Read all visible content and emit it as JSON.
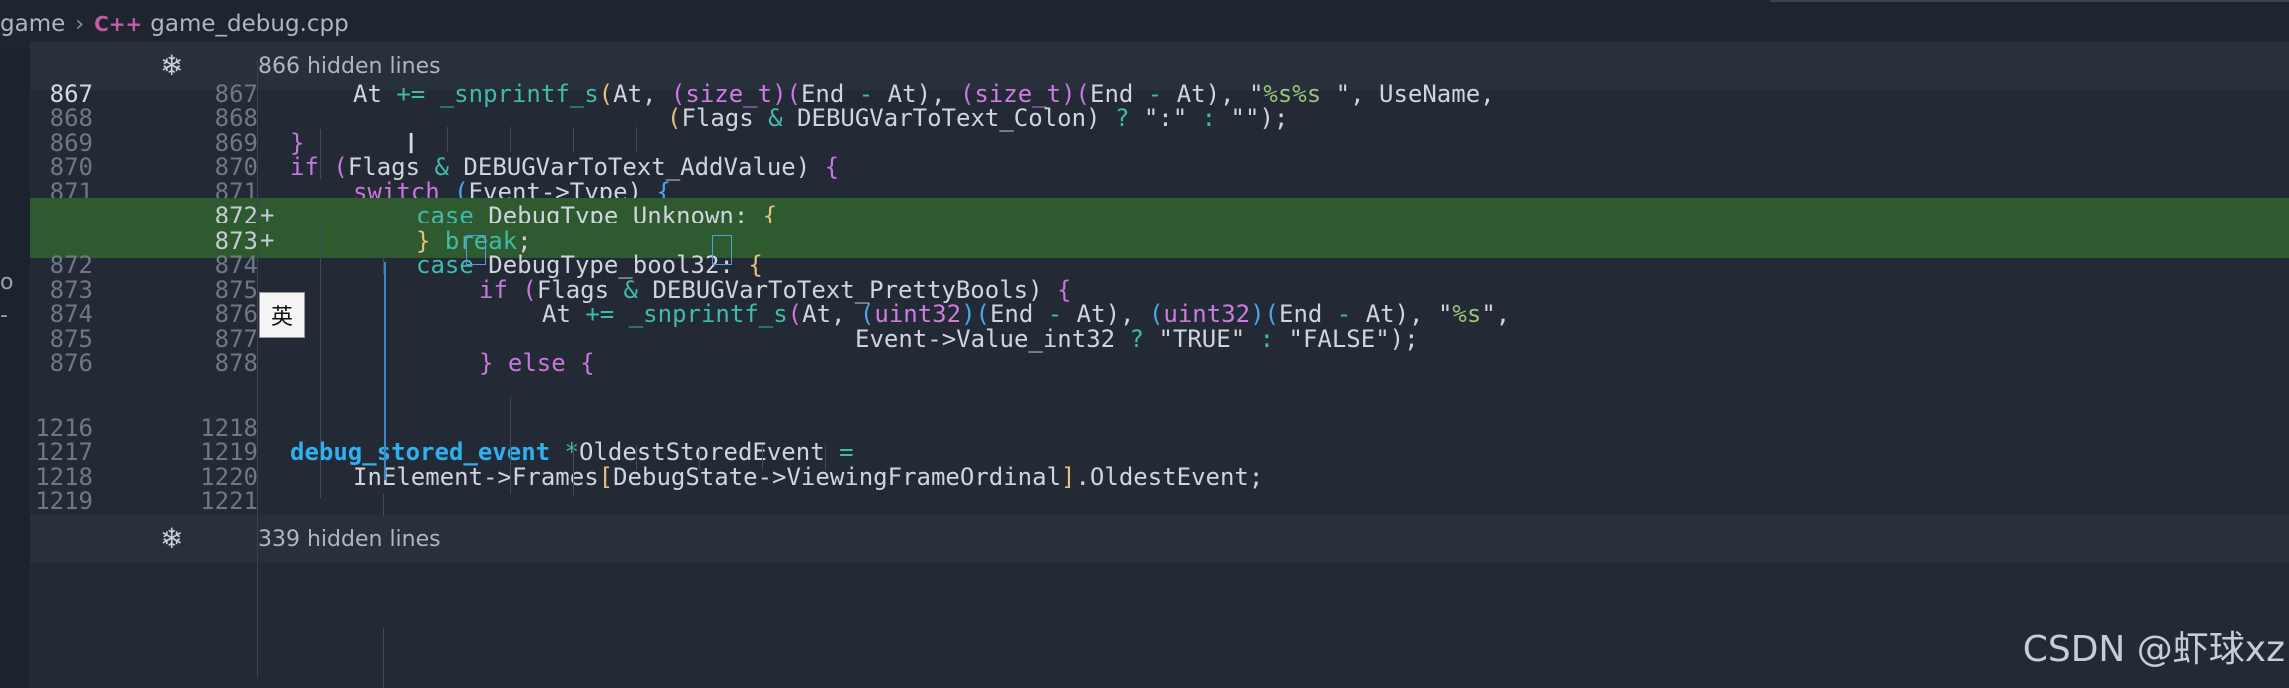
{
  "breadcrumb": {
    "folder": "game",
    "lang_badge": "C++",
    "file": "game_debug.cpp"
  },
  "hidden_top": {
    "icon": "snowflake-icon",
    "label": "866 hidden lines"
  },
  "hidden_mid": {
    "icon": "snowflake-icon",
    "label": "339 hidden lines"
  },
  "ime_indicator": "英",
  "watermark": "CSDN @虾球xz",
  "gutter_marks": {
    "a": "o",
    "b": "-"
  },
  "lines": [
    {
      "old": "867",
      "new": "867",
      "plus": ""
    },
    {
      "old": "868",
      "new": "868",
      "plus": ""
    },
    {
      "old": "869",
      "new": "869",
      "plus": ""
    },
    {
      "old": "870",
      "new": "870",
      "plus": ""
    },
    {
      "old": "871",
      "new": "871",
      "plus": ""
    },
    {
      "old": "",
      "new": "872",
      "plus": "+"
    },
    {
      "old": "",
      "new": "873",
      "plus": "+"
    },
    {
      "old": "872",
      "new": "874",
      "plus": ""
    },
    {
      "old": "873",
      "new": "875",
      "plus": ""
    },
    {
      "old": "874",
      "new": "876",
      "plus": ""
    },
    {
      "old": "875",
      "new": "877",
      "plus": ""
    },
    {
      "old": "876",
      "new": "878",
      "plus": ""
    },
    {
      "old": "1216",
      "new": "1218",
      "plus": ""
    },
    {
      "old": "1217",
      "new": "1219",
      "plus": ""
    },
    {
      "old": "1218",
      "new": "1220",
      "plus": ""
    },
    {
      "old": "1219",
      "new": "1221",
      "plus": ""
    }
  ],
  "code": {
    "l0": [
      "At",
      " ",
      "+=",
      " ",
      "_snprintf_s",
      "(",
      "At, ",
      "(",
      "size_t",
      ")",
      "(",
      "End ",
      "-",
      " At), ",
      "(",
      "size_t",
      ")",
      "(",
      "End ",
      "-",
      " At), ",
      "\"",
      "%s%s",
      " \", UseName,"
    ],
    "l1": [
      "(",
      "Flags ",
      "&",
      " DEBUGVarToText_Colon) ",
      "?",
      " \":\" ",
      ":",
      " \"\");"
    ],
    "l2": [
      "}"
    ],
    "l3": [
      "if",
      " ",
      "(",
      "Flags ",
      "&",
      " DEBUGVarToText_AddValue) ",
      "{"
    ],
    "l4": [
      "switch",
      " ",
      "(",
      "Event->Type) ",
      "{"
    ],
    "l5": [
      "case",
      " DebugType_Unknown: ",
      "{"
    ],
    "l6": [
      "}",
      " ",
      "break",
      ";"
    ],
    "l7": [
      "case",
      " DebugType_bool32: ",
      "{"
    ],
    "l8": [
      "if",
      " ",
      "(",
      "Flags ",
      "&",
      " DEBUGVarToText_PrettyBools) ",
      "{"
    ],
    "l9": [
      "At",
      " ",
      "+=",
      " ",
      "_snprintf_s",
      "(",
      "At, ",
      "(",
      "uint32",
      ")",
      "(",
      "End ",
      "-",
      " At), ",
      "(",
      "uint32",
      ")",
      "(",
      "End ",
      "-",
      " At), ",
      "\"",
      "%s",
      "\","
    ],
    "l10": [
      "Event->Value_int32 ",
      "?",
      " \"TRUE\" ",
      ":",
      " \"FALSE\");"
    ],
    "l11": [
      "}",
      " ",
      "else",
      " ",
      "{"
    ],
    "l12": [
      ""
    ],
    "l13": [
      "debug_stored_event",
      " ",
      "*",
      "OldestStoredEvent ",
      "="
    ],
    "l14": [
      "InElement->Frames",
      "[",
      "DebugState->ViewingFrameOrdinal",
      "]",
      ".OldestEvent;"
    ],
    "l15": [
      ""
    ]
  }
}
